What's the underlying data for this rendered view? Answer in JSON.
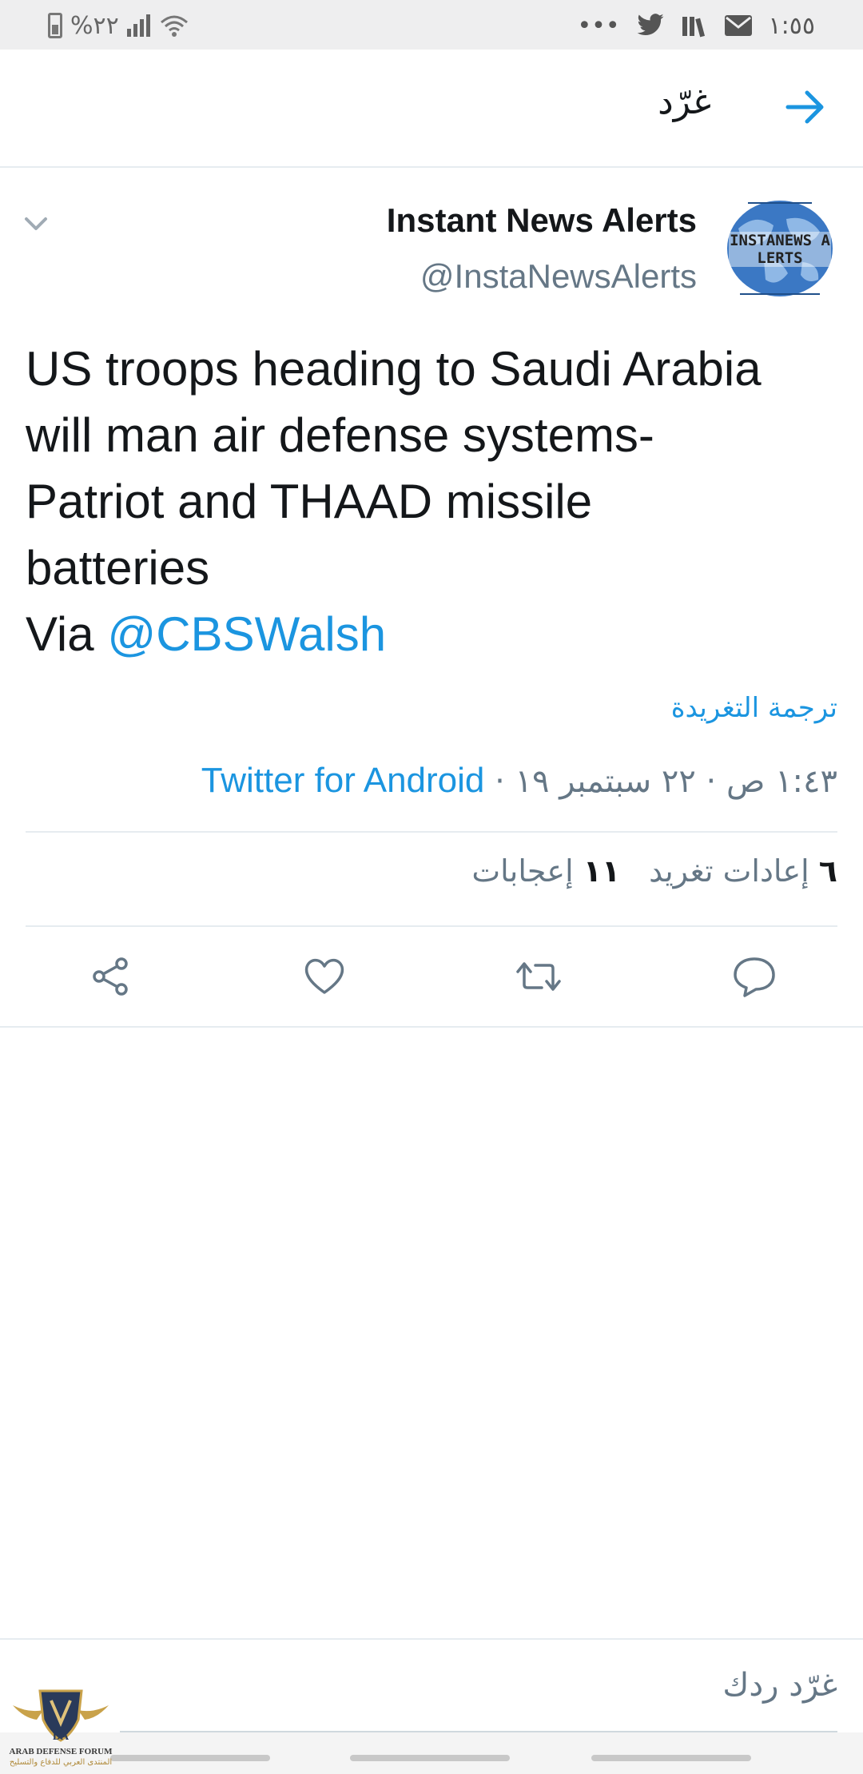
{
  "status_bar": {
    "battery": "%٢٢",
    "time": "١:٥٥",
    "overflow": "•••",
    "icons": [
      "battery-icon",
      "signal-icon",
      "wifi-icon",
      "twitter-icon",
      "library-icon",
      "mail-icon"
    ]
  },
  "header": {
    "title": "غرّد",
    "back_icon": "arrow-right-icon"
  },
  "tweet": {
    "author_name": "Instant News Alerts",
    "author_handle": "@InstaNewsAlerts",
    "avatar_text": "INSTANEWS ALERTS",
    "text": "US troops heading to Saudi Arabia\nwill man air defense systems-\nPatriot and THAAD missile\nbatteries\nVia ",
    "mention": "@CBSWalsh",
    "translate_label": "ترجمة التغريدة",
    "timestamp": "١:٤٣ ص · ٢٢ سبتمبر ١٩ · ",
    "client": "Twitter for Android",
    "retweets_count": "٦",
    "retweets_label": "إعادات تغريد",
    "likes_count": "١١",
    "likes_label": "إعجابات"
  },
  "actions": [
    "reply-icon",
    "retweet-icon",
    "like-icon",
    "share-icon"
  ],
  "reply_bar": {
    "placeholder": "غرّد ردك"
  },
  "watermark": {
    "title": "ARAB DEFENSE FORUM",
    "subtitle": "المنتدى العربي للدفاع والتسليح",
    "mark": "DA"
  },
  "colors": {
    "accent": "#1b95e0",
    "text": "#14171a",
    "muted": "#657786",
    "divider": "#e6ecf0"
  }
}
